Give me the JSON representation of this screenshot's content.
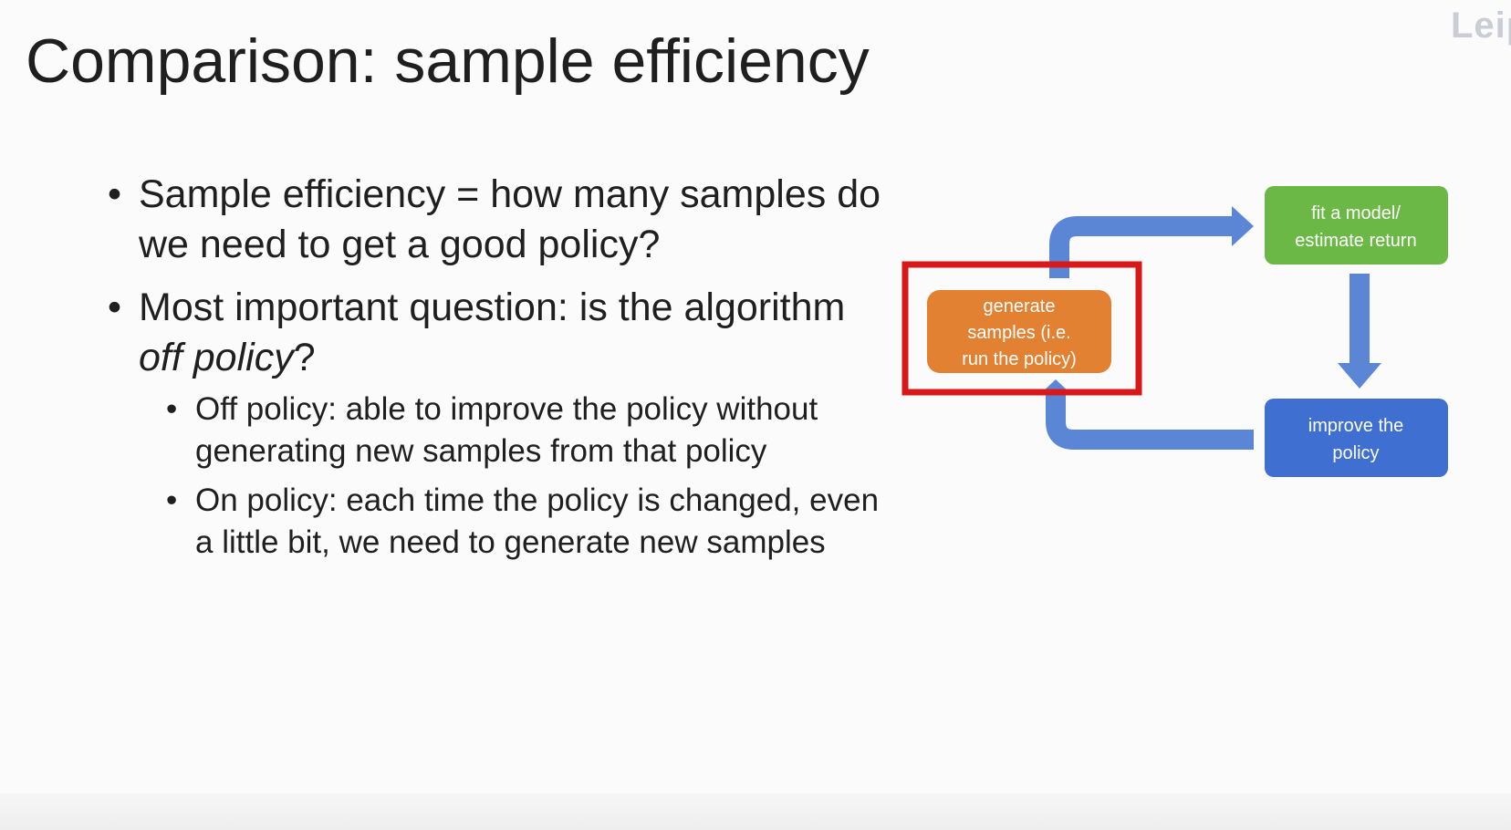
{
  "slide": {
    "title": "Comparison: sample efficiency",
    "watermark": "Leip",
    "bullets": [
      {
        "text": "Sample efficiency = how many samples do we need to get a good policy?"
      },
      {
        "text_before": "Most important question: is the algorithm ",
        "text_italic": "off policy",
        "text_after": "?",
        "sub_bullets": [
          "Off policy: able to improve the policy without generating new samples from that policy",
          "On policy: each time the policy is changed, even a little bit, we need to generate new samples"
        ]
      }
    ]
  },
  "diagram": {
    "nodes": {
      "generate": {
        "lines": [
          "generate",
          "samples (i.e.",
          "run the policy)"
        ],
        "color": "#e38132"
      },
      "fit": {
        "lines": [
          "fit a model/",
          "estimate return"
        ],
        "color": "#6bb846"
      },
      "improve": {
        "lines": [
          "improve the",
          "policy"
        ],
        "color": "#3f6fd0"
      }
    },
    "arrow_color": "#5b86d6",
    "highlight_color": "#d7191c"
  }
}
